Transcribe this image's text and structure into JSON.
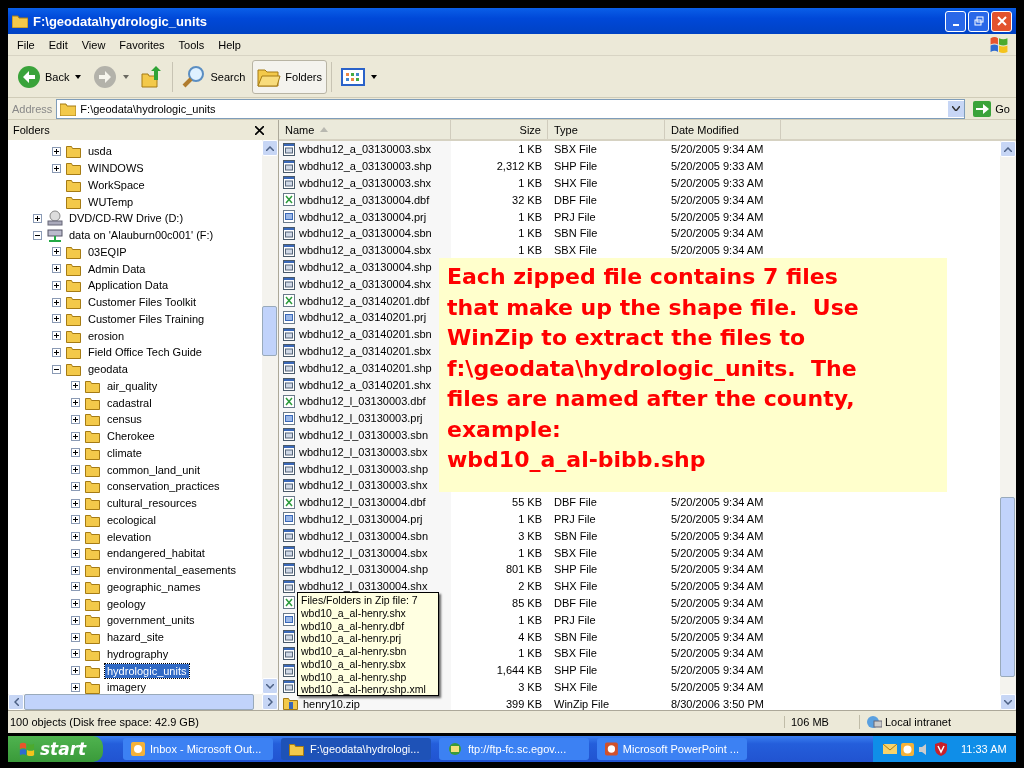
{
  "window": {
    "title": "F:\\geodata\\hydrologic_units"
  },
  "menu": [
    "File",
    "Edit",
    "View",
    "Favorites",
    "Tools",
    "Help"
  ],
  "toolbar": [
    {
      "kind": "back",
      "label": "Back",
      "disabled": false,
      "pressed": false
    },
    {
      "kind": "forward",
      "disabled": true,
      "pressed": false
    },
    {
      "kind": "up",
      "disabled": false,
      "pressed": false
    },
    {
      "kind": "search",
      "label": "Search",
      "disabled": false,
      "pressed": false
    },
    {
      "kind": "folders",
      "label": "Folders",
      "disabled": false,
      "pressed": true
    },
    {
      "kind": "views",
      "disabled": false,
      "pressed": false
    }
  ],
  "address": {
    "label": "Address",
    "value": "F:\\geodata\\hydrologic_units",
    "go": "Go"
  },
  "folders_pane": {
    "title": "Folders"
  },
  "tree": {
    "partial_items": [
      {
        "label": "usda",
        "kind": "folder",
        "expandable": true,
        "expanded": false,
        "selected": false
      },
      {
        "label": "WINDOWS",
        "kind": "folder",
        "expandable": true,
        "expanded": false,
        "selected": false
      },
      {
        "label": "WorkSpace",
        "kind": "folder",
        "expandable": false,
        "selected": false
      },
      {
        "label": "WUTemp",
        "kind": "folder",
        "expandable": false,
        "selected": false
      }
    ],
    "items": [
      {
        "label": "DVD/CD-RW Drive (D:)",
        "kind": "cd-drive",
        "expandable": true,
        "expanded": false,
        "selected": false
      },
      {
        "label": "data on 'Alauburn00c001' (F:)",
        "kind": "network-drive",
        "expandable": true,
        "expanded": true,
        "selected": false,
        "children": [
          {
            "label": "03EQIP",
            "kind": "folder",
            "expandable": true,
            "expanded": false,
            "selected": false
          },
          {
            "label": "Admin Data",
            "kind": "folder",
            "expandable": true,
            "expanded": false,
            "selected": false
          },
          {
            "label": "Application Data",
            "kind": "folder",
            "expandable": true,
            "expanded": false,
            "selected": false
          },
          {
            "label": "Customer Files Toolkit",
            "kind": "folder",
            "expandable": true,
            "expanded": false,
            "selected": false
          },
          {
            "label": "Customer Files Training",
            "kind": "folder",
            "expandable": true,
            "expanded": false,
            "selected": false
          },
          {
            "label": "erosion",
            "kind": "folder",
            "expandable": true,
            "expanded": false,
            "selected": false
          },
          {
            "label": "Field Office Tech Guide",
            "kind": "folder",
            "expandable": true,
            "expanded": false,
            "selected": false
          },
          {
            "label": "geodata",
            "kind": "folder",
            "expandable": true,
            "expanded": true,
            "selected": false,
            "children": [
              {
                "label": "air_quality",
                "kind": "folder",
                "expandable": true,
                "expanded": false,
                "selected": false
              },
              {
                "label": "cadastral",
                "kind": "folder",
                "expandable": true,
                "expanded": false,
                "selected": false
              },
              {
                "label": "census",
                "kind": "folder",
                "expandable": true,
                "expanded": false,
                "selected": false
              },
              {
                "label": "Cherokee",
                "kind": "folder",
                "expandable": true,
                "expanded": false,
                "selected": false
              },
              {
                "label": "climate",
                "kind": "folder",
                "expandable": true,
                "expanded": false,
                "selected": false
              },
              {
                "label": "common_land_unit",
                "kind": "folder",
                "expandable": true,
                "expanded": false,
                "selected": false
              },
              {
                "label": "conservation_practices",
                "kind": "folder",
                "expandable": true,
                "expanded": false,
                "selected": false
              },
              {
                "label": "cultural_resources",
                "kind": "folder",
                "expandable": true,
                "expanded": false,
                "selected": false
              },
              {
                "label": "ecological",
                "kind": "folder",
                "expandable": true,
                "expanded": false,
                "selected": false
              },
              {
                "label": "elevation",
                "kind": "folder",
                "expandable": true,
                "expanded": false,
                "selected": false
              },
              {
                "label": "endangered_habitat",
                "kind": "folder",
                "expandable": true,
                "expanded": false,
                "selected": false
              },
              {
                "label": "environmental_easements",
                "kind": "folder",
                "expandable": true,
                "expanded": false,
                "selected": false
              },
              {
                "label": "geographic_names",
                "kind": "folder",
                "expandable": true,
                "expanded": false,
                "selected": false
              },
              {
                "label": "geology",
                "kind": "folder",
                "expandable": true,
                "expanded": false,
                "selected": false
              },
              {
                "label": "government_units",
                "kind": "folder",
                "expandable": true,
                "expanded": false,
                "selected": false
              },
              {
                "label": "hazard_site",
                "kind": "folder",
                "expandable": true,
                "expanded": false,
                "selected": false
              },
              {
                "label": "hydrography",
                "kind": "folder",
                "expandable": true,
                "expanded": false,
                "selected": false
              },
              {
                "label": "hydrologic_units",
                "kind": "folder",
                "expandable": true,
                "expanded": false,
                "selected": true
              },
              {
                "label": "imagery",
                "kind": "folder",
                "expandable": true,
                "expanded": false,
                "selected": false
              }
            ]
          }
        ]
      }
    ]
  },
  "columns": [
    {
      "label": "Name",
      "sorted": true
    },
    {
      "label": "Size",
      "sorted": false
    },
    {
      "label": "Type",
      "sorted": false
    },
    {
      "label": "Date Modified",
      "sorted": false
    }
  ],
  "files": [
    {
      "kind": "data",
      "name": "wbdhu12_a_03130003.sbx",
      "size": "1 KB",
      "type": "SBX File",
      "modified": "5/20/2005 9:34 AM"
    },
    {
      "kind": "data",
      "name": "wbdhu12_a_03130003.shp",
      "size": "2,312 KB",
      "type": "SHP File",
      "modified": "5/20/2005 9:33 AM"
    },
    {
      "kind": "data",
      "name": "wbdhu12_a_03130003.shx",
      "size": "1 KB",
      "type": "SHX File",
      "modified": "5/20/2005 9:33 AM"
    },
    {
      "kind": "dbf",
      "name": "wbdhu12_a_03130004.dbf",
      "size": "32 KB",
      "type": "DBF File",
      "modified": "5/20/2005 9:34 AM"
    },
    {
      "kind": "prj",
      "name": "wbdhu12_a_03130004.prj",
      "size": "1 KB",
      "type": "PRJ File",
      "modified": "5/20/2005 9:34 AM"
    },
    {
      "kind": "data",
      "name": "wbdhu12_a_03130004.sbn",
      "size": "1 KB",
      "type": "SBN File",
      "modified": "5/20/2005 9:34 AM"
    },
    {
      "kind": "data",
      "name": "wbdhu12_a_03130004.sbx",
      "size": "1 KB",
      "type": "SBX File",
      "modified": "5/20/2005 9:34 AM"
    },
    {
      "kind": "data",
      "name": "wbdhu12_a_03130004.shp"
    },
    {
      "kind": "data",
      "name": "wbdhu12_a_03130004.shx"
    },
    {
      "kind": "dbf",
      "name": "wbdhu12_a_03140201.dbf"
    },
    {
      "kind": "prj",
      "name": "wbdhu12_a_03140201.prj"
    },
    {
      "kind": "data",
      "name": "wbdhu12_a_03140201.sbn"
    },
    {
      "kind": "data",
      "name": "wbdhu12_a_03140201.sbx"
    },
    {
      "kind": "data",
      "name": "wbdhu12_a_03140201.shp"
    },
    {
      "kind": "data",
      "name": "wbdhu12_a_03140201.shx"
    },
    {
      "kind": "dbf",
      "name": "wbdhu12_l_03130003.dbf"
    },
    {
      "kind": "prj",
      "name": "wbdhu12_l_03130003.prj"
    },
    {
      "kind": "data",
      "name": "wbdhu12_l_03130003.sbn"
    },
    {
      "kind": "data",
      "name": "wbdhu12_l_03130003.sbx"
    },
    {
      "kind": "data",
      "name": "wbdhu12_l_03130003.shp"
    },
    {
      "kind": "data",
      "name": "wbdhu12_l_03130003.shx"
    },
    {
      "kind": "dbf",
      "name": "wbdhu12_l_03130004.dbf",
      "size": "55 KB",
      "type": "DBF File",
      "modified": "5/20/2005 9:34 AM"
    },
    {
      "kind": "prj",
      "name": "wbdhu12_l_03130004.prj",
      "size": "1 KB",
      "type": "PRJ File",
      "modified": "5/20/2005 9:34 AM"
    },
    {
      "kind": "data",
      "name": "wbdhu12_l_03130004.sbn",
      "size": "3 KB",
      "type": "SBN File",
      "modified": "5/20/2005 9:34 AM"
    },
    {
      "kind": "data",
      "name": "wbdhu12_l_03130004.sbx",
      "size": "1 KB",
      "type": "SBX File",
      "modified": "5/20/2005 9:34 AM"
    },
    {
      "kind": "data",
      "name": "wbdhu12_l_03130004.shp",
      "size": "801 KB",
      "type": "SHP File",
      "modified": "5/20/2005 9:34 AM"
    },
    {
      "kind": "data",
      "name": "wbdhu12_l_03130004.shx",
      "size": "2 KB",
      "type": "SHX File",
      "modified": "5/20/2005 9:34 AM"
    },
    {
      "kind": "dbf",
      "size": "85 KB",
      "type": "DBF File",
      "modified": "5/20/2005 9:34 AM"
    },
    {
      "kind": "prj",
      "size": "1 KB",
      "type": "PRJ File",
      "modified": "5/20/2005 9:34 AM"
    },
    {
      "kind": "data",
      "size": "4 KB",
      "type": "SBN File",
      "modified": "5/20/2005 9:34 AM"
    },
    {
      "kind": "data",
      "size": "1 KB",
      "type": "SBX File",
      "modified": "5/20/2005 9:34 AM"
    },
    {
      "kind": "data",
      "size": "1,644 KB",
      "type": "SHP File",
      "modified": "5/20/2005 9:34 AM"
    },
    {
      "kind": "data",
      "size": "3 KB",
      "type": "SHX File",
      "modified": "5/20/2005 9:34 AM"
    },
    {
      "kind": "zip",
      "name": "henry10.zip",
      "size": "399 KB",
      "type": "WinZip File",
      "modified": "8/30/2006 3:50 PM"
    }
  ],
  "note": {
    "text": "Each zipped file contains 7 files\nthat make up the shape file.  Use\nWinZip to extract the files to\nf:\\geodata\\hydrologic_units.  The\nfiles are named after the county,\nexample:\nwbd10_a_al-bibb.shp"
  },
  "tooltip": {
    "title": "Files/Folders in Zip file: 7",
    "entries": [
      "wbd10_a_al-henry.shx",
      "wbd10_a_al-henry.dbf",
      "wbd10_a_al-henry.prj",
      "wbd10_a_al-henry.sbn",
      "wbd10_a_al-henry.sbx",
      "wbd10_a_al-henry.shp",
      "wbd10_a_al-henry.shp.xml"
    ]
  },
  "status_bar": {
    "summary": "100 objects (Disk free space: 42.9 GB)",
    "size": "106 MB",
    "zone": "Local intranet"
  },
  "taskbar": {
    "start": "start",
    "buttons": [
      {
        "kind": "mail",
        "label": "Inbox - Microsoft Out...",
        "selected": false
      },
      {
        "kind": "folder",
        "label": "F:\\geodata\\hydrologi...",
        "selected": true
      },
      {
        "kind": "ftp",
        "label": "ftp://ftp-fc.sc.egov....",
        "selected": false
      },
      {
        "kind": "slides",
        "label": "Microsoft PowerPoint ...",
        "selected": false
      }
    ],
    "clock": "11:33 AM"
  }
}
